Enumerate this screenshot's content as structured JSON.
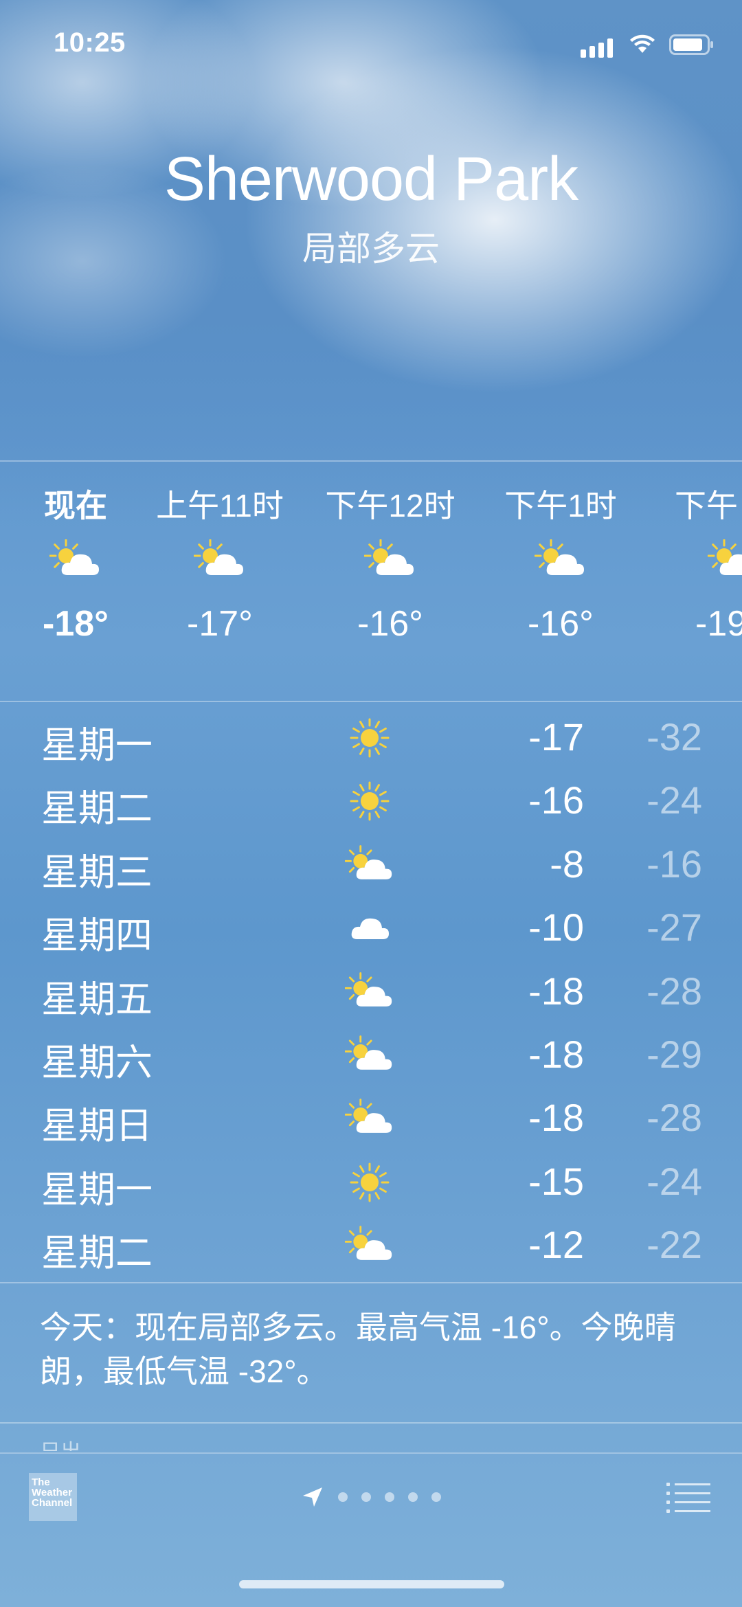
{
  "status_bar": {
    "time": "10:25"
  },
  "location": {
    "city": "Sherwood Park",
    "condition": "局部多云"
  },
  "hourly": [
    {
      "label": "现在",
      "temp": "-18°",
      "icon": "partly-cloudy-icon"
    },
    {
      "label": "上午11时",
      "temp": "-17°",
      "icon": "partly-cloudy-icon"
    },
    {
      "label": "下午12时",
      "temp": "-16°",
      "icon": "partly-cloudy-icon"
    },
    {
      "label": "下午1时",
      "temp": "-16°",
      "icon": "partly-cloudy-icon"
    },
    {
      "label": "下午",
      "temp": "-19",
      "icon": "partly-cloudy-icon"
    }
  ],
  "daily": [
    {
      "day": "星期一",
      "icon": "sun-icon",
      "high": "-17",
      "low": "-32"
    },
    {
      "day": "星期二",
      "icon": "sun-icon",
      "high": "-16",
      "low": "-24"
    },
    {
      "day": "星期三",
      "icon": "partly-cloudy-icon",
      "high": "-8",
      "low": "-16"
    },
    {
      "day": "星期四",
      "icon": "cloud-icon",
      "high": "-10",
      "low": "-27"
    },
    {
      "day": "星期五",
      "icon": "partly-cloudy-icon",
      "high": "-18",
      "low": "-28"
    },
    {
      "day": "星期六",
      "icon": "partly-cloudy-icon",
      "high": "-18",
      "low": "-29"
    },
    {
      "day": "星期日",
      "icon": "partly-cloudy-icon",
      "high": "-18",
      "low": "-28"
    },
    {
      "day": "星期一",
      "icon": "sun-icon",
      "high": "-15",
      "low": "-24"
    },
    {
      "day": "星期二",
      "icon": "partly-cloudy-icon",
      "high": "-12",
      "low": "-22"
    }
  ],
  "summary": "今天：现在局部多云。最高气温 -16°。今晚晴朗，最低气温 -32°。",
  "next_section_peek": "日出",
  "tab_bar": {
    "provider_logo_text": "The Weather Channel",
    "page_dots": 5,
    "location_icon": "location-arrow-icon",
    "list_icon": "list-icon"
  },
  "colors": {
    "sun": "#f7d23e",
    "cloud": "#ffffff",
    "low_temp": "rgba(255,255,255,0.55)"
  }
}
